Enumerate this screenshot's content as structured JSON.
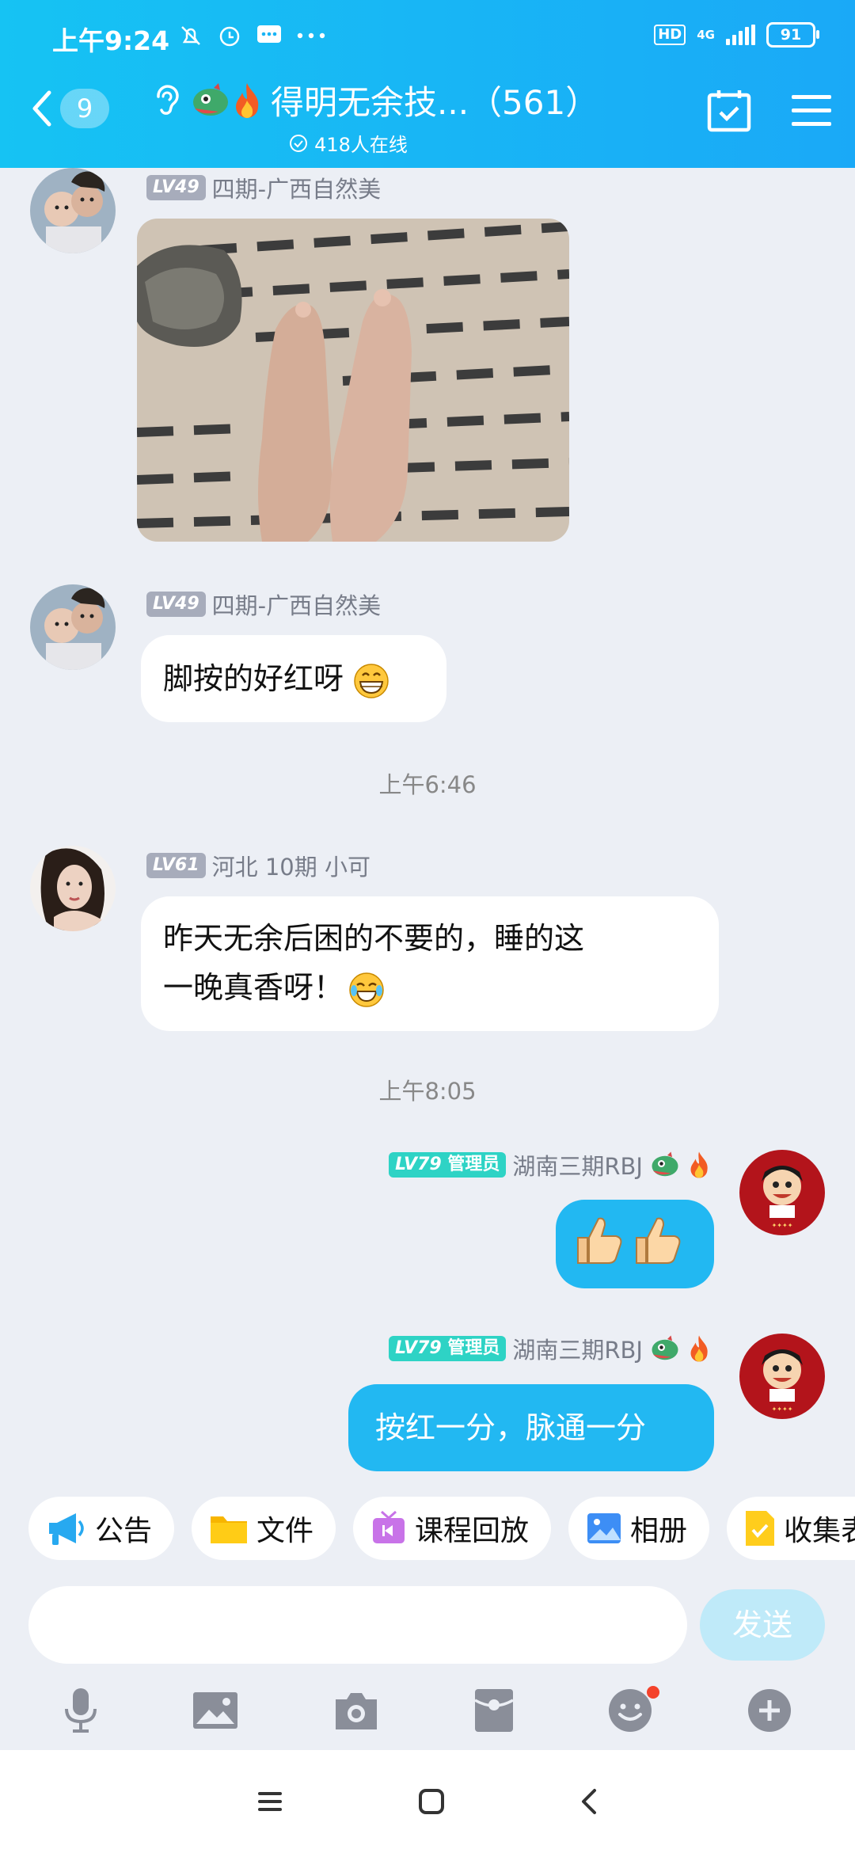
{
  "status_bar": {
    "time": "上午9:24",
    "network": "4G",
    "battery": "91",
    "hd": "HD"
  },
  "header": {
    "unread_count": "9",
    "title": "得明无余技...（561）",
    "online_text": "418人在线"
  },
  "messages": [
    {
      "level": "LV49",
      "sender": "四期-广西自然美",
      "type": "image"
    },
    {
      "level": "LV49",
      "sender": "四期-广西自然美",
      "text": "脚按的好红呀"
    },
    {
      "type": "time",
      "text": "上午6:46"
    },
    {
      "level": "LV61",
      "sender": "河北 10期 小可",
      "line1": "昨天无余后困的不要的，睡的这",
      "line2": "一晚真香呀！"
    },
    {
      "type": "time",
      "text": "上午8:05"
    },
    {
      "level": "LV79",
      "role": "管理员",
      "sender": "湖南三期RBJ",
      "text": "👍👍"
    },
    {
      "level": "LV79",
      "role": "管理员",
      "sender": "湖南三期RBJ",
      "text": "按红一分，脉通一分"
    }
  ],
  "quick_actions": [
    "公告",
    "文件",
    "课程回放",
    "相册",
    "收集表"
  ],
  "input": {
    "placeholder": "",
    "send_label": "发送"
  },
  "colors": {
    "header": "#19b4f5",
    "bubble_mine": "#22b8f2",
    "admin_badge": "#2ed3c5"
  }
}
